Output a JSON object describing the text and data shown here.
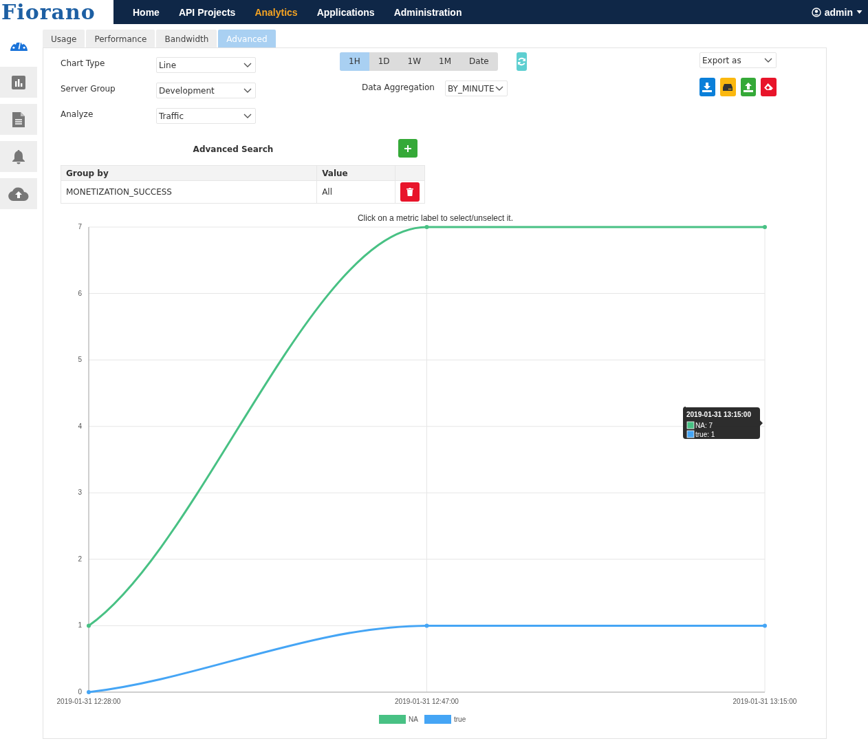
{
  "logo": "Fiorano",
  "nav": [
    {
      "label": "Home",
      "selected": false
    },
    {
      "label": "API Projects",
      "selected": false
    },
    {
      "label": "Analytics",
      "selected": true
    },
    {
      "label": "Applications",
      "selected": false
    },
    {
      "label": "Administration",
      "selected": false
    }
  ],
  "user": {
    "label": "admin"
  },
  "sidebar": {
    "items": [
      {
        "kind": "dashboard",
        "selected": true
      },
      {
        "kind": "chart",
        "selected": false
      },
      {
        "kind": "document",
        "selected": false
      },
      {
        "kind": "bell",
        "selected": false
      },
      {
        "kind": "cloud",
        "selected": false
      }
    ]
  },
  "tabs": [
    {
      "label": "Usage",
      "selected": false
    },
    {
      "label": "Performance",
      "selected": false
    },
    {
      "label": "Bandwidth",
      "selected": false
    },
    {
      "label": "Advanced",
      "selected": true
    }
  ],
  "form": [
    {
      "label": "Chart Type",
      "value": "Line"
    },
    {
      "label": "Server Group",
      "value": "Development"
    },
    {
      "label": "Analyze",
      "value": "Traffic"
    }
  ],
  "ranges": [
    {
      "label": "1H",
      "selected": true
    },
    {
      "label": "1D",
      "selected": false
    },
    {
      "label": "1W",
      "selected": false
    },
    {
      "label": "1M",
      "selected": false
    },
    {
      "label": "Date",
      "selected": false
    }
  ],
  "aggregation": {
    "label": "Data Aggregation",
    "value": "BY_MINUTE"
  },
  "export": {
    "value": "Export as"
  },
  "actions": [
    {
      "kind": "download",
      "color": "#0a7fd9"
    },
    {
      "kind": "drive",
      "color": "#fbb80f"
    },
    {
      "kind": "upload",
      "color": "#35a938"
    },
    {
      "kind": "eraser",
      "color": "#e8142a"
    }
  ],
  "advanced_search": {
    "title": "Advanced Search",
    "columns": [
      "Group by",
      "Value"
    ],
    "rows": [
      [
        "MONETIZATION_SUCCESS",
        "All"
      ]
    ]
  },
  "chart_note": "Click on a metric label to select/unselect it.",
  "chart_data": {
    "type": "line",
    "categories": [
      "2019-01-31 12:28:00",
      "2019-01-31 12:47:00",
      "2019-01-31 13:15:00"
    ],
    "yticks": [
      0,
      1,
      2,
      3,
      4,
      5,
      6,
      7
    ],
    "ylim": [
      0,
      7
    ],
    "grid": true,
    "legend": "bottom",
    "series": [
      {
        "name": "NA",
        "color": "#48c184",
        "marker": "circle",
        "values": [
          1,
          7,
          7
        ]
      },
      {
        "name": "true",
        "color": "#45a5f5",
        "marker": "circle",
        "values": [
          0,
          1,
          1
        ]
      }
    ]
  },
  "tooltip": {
    "title": "2019-01-31 13:15:00",
    "items": [
      "NA: 7",
      "true: 1"
    ]
  }
}
